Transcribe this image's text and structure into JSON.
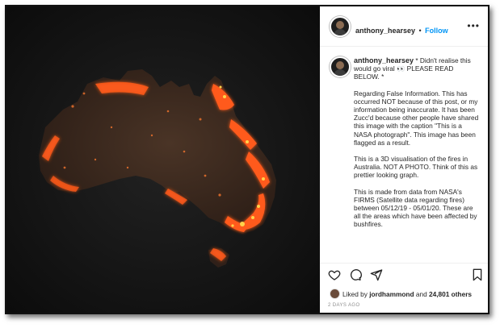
{
  "post": {
    "username": "anthony_hearsey",
    "separator": "•",
    "follow_label": "Follow",
    "more_label": "•••"
  },
  "caption": {
    "username": "anthony_hearsey",
    "paragraphs": [
      "* Didn't realise this would go viral 👀 PLEASE READ BELOW. *",
      "Regarding False Information. This has occurred NOT because of this post, or my information being inaccurate. It has been Zucc'd because other people have shared this image with the caption \"This is a NASA photograph\". This image has been flagged as a result.",
      "This is a 3D visualisation of the fires in Australia. NOT A PHOTO. Think of this as prettier looking graph.",
      "This is made from data from NASA's FIRMS (Satellite data regarding fires) between 05/12/19 - 05/01/20. These are all the areas which have been affected by bushfires."
    ]
  },
  "likes": {
    "prefix": "Liked by",
    "user": "jordhammond",
    "conjunction": "and",
    "others": "24,801 others"
  },
  "timestamp": "2 DAYS AGO",
  "icons": {
    "like": "heart-icon",
    "comment": "comment-icon",
    "share": "share-icon",
    "save": "bookmark-icon"
  },
  "colors": {
    "follow": "#0095f6",
    "fire": "#ff5a1a",
    "land": "#3d2a20"
  }
}
